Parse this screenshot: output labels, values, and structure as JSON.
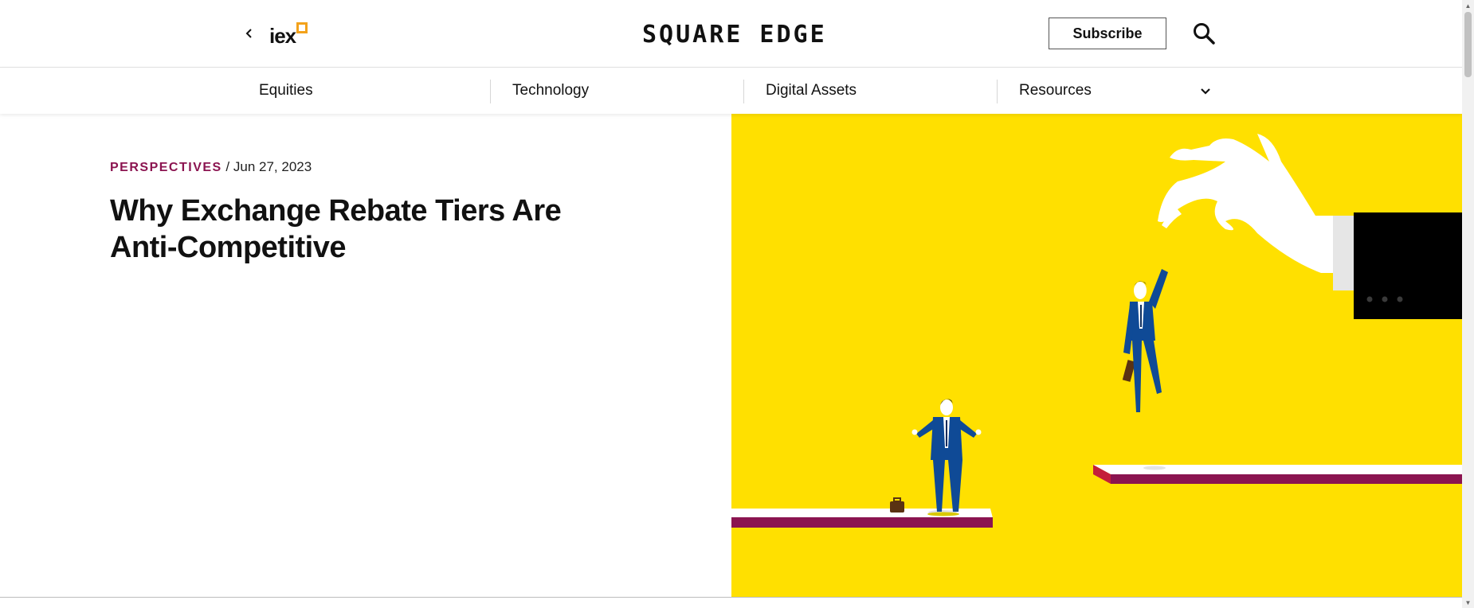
{
  "header": {
    "back_icon": "chevron-left-icon",
    "logo_text": "iex",
    "brand": "SQUARE EDGE",
    "subscribe_label": "Subscribe",
    "search_icon": "search-icon"
  },
  "nav": {
    "items": [
      {
        "label": "Equities"
      },
      {
        "label": "Technology"
      },
      {
        "label": "Digital Assets"
      },
      {
        "label": "Resources"
      }
    ],
    "dropdown_icon": "chevron-down-icon"
  },
  "article": {
    "category": "PERSPECTIVES",
    "separator": " / ",
    "date": "Jun 27, 2023",
    "title": "Why Exchange Rebate Tiers Are Anti-Competitive"
  },
  "colors": {
    "accent": "#8b1450",
    "hero_bg": "#ffe000",
    "suit": "#0f4a96",
    "logo_square": "#f3a21b"
  }
}
